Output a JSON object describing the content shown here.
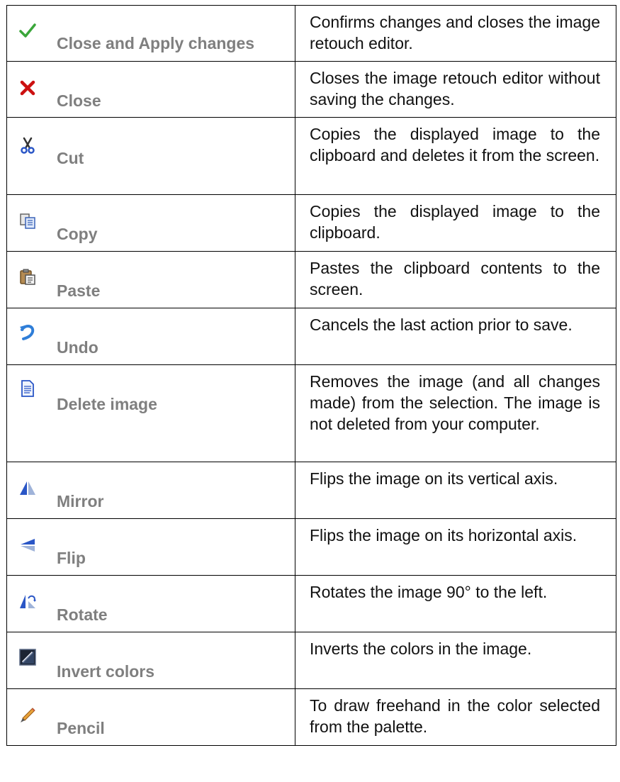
{
  "commands": [
    {
      "icon": "checkmark-icon",
      "label": "Close and Apply changes",
      "description": "Confirms changes and closes the image retouch editor."
    },
    {
      "icon": "close-icon",
      "label": "Close",
      "description": "Closes the image retouch editor without saving the changes."
    },
    {
      "icon": "scissors-icon",
      "label": "Cut",
      "description": "Copies the displayed image to the clipboard and deletes it from the screen."
    },
    {
      "icon": "copy-icon",
      "label": "Copy",
      "description": "Copies the displayed image to the clipboard."
    },
    {
      "icon": "paste-icon",
      "label": "Paste",
      "description": "Pastes the clipboard contents to the screen."
    },
    {
      "icon": "undo-icon",
      "label": "Undo",
      "description": "Cancels the last action prior to save."
    },
    {
      "icon": "document-icon",
      "label": "Delete image",
      "description": "Removes the image (and all changes made) from the selection. The image is not deleted from your computer."
    },
    {
      "icon": "mirror-icon",
      "label": "Mirror",
      "description": "Flips the image on its vertical axis."
    },
    {
      "icon": "flip-icon",
      "label": "Flip",
      "description": "Flips the image on its horizontal axis."
    },
    {
      "icon": "rotate-icon",
      "label": "Rotate",
      "description": "Rotates the image 90° to the left."
    },
    {
      "icon": "invert-colors-icon",
      "label": "Invert colors",
      "description": "Inverts the colors in the image."
    },
    {
      "icon": "pencil-icon",
      "label": "Pencil",
      "description": "To draw freehand in the color selected from the palette."
    }
  ]
}
